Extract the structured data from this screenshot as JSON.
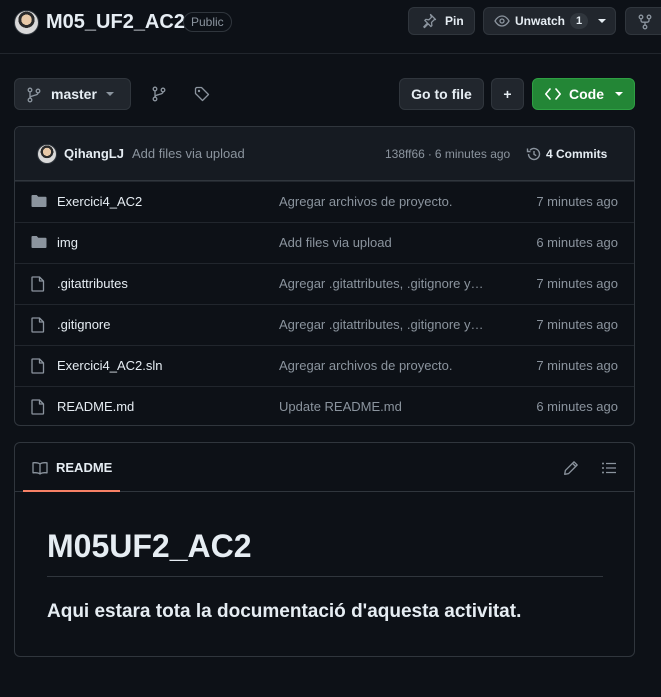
{
  "repo": {
    "name": "M05_UF2_AC2",
    "visibility": "Public"
  },
  "header_actions": {
    "pin_label": "Pin",
    "unwatch_label": "Unwatch",
    "watch_count": "1"
  },
  "toolbar": {
    "branch": "master",
    "goto_file": "Go to file",
    "add": "+",
    "code": "Code"
  },
  "latest_commit": {
    "author": "QihangLJ",
    "message": "Add files via upload",
    "sha": "138ff66",
    "separator": "·",
    "time": "6 minutes ago",
    "commits_label": "4 Commits"
  },
  "files": [
    {
      "type": "folder",
      "name": "Exercici4_AC2",
      "message": "Agregar archivos de proyecto.",
      "date": "7 minutes ago"
    },
    {
      "type": "folder",
      "name": "img",
      "message": "Add files via upload",
      "date": "6 minutes ago"
    },
    {
      "type": "file",
      "name": ".gitattributes",
      "message": "Agregar .gitattributes, .gitignore y…",
      "date": "7 minutes ago"
    },
    {
      "type": "file",
      "name": ".gitignore",
      "message": "Agregar .gitattributes, .gitignore y…",
      "date": "7 minutes ago"
    },
    {
      "type": "file",
      "name": "Exercici4_AC2.sln",
      "message": "Agregar archivos de proyecto.",
      "date": "7 minutes ago"
    },
    {
      "type": "file",
      "name": "README.md",
      "message": "Update README.md",
      "date": "6 minutes ago"
    }
  ],
  "readme": {
    "tab_label": "README",
    "heading": "M05UF2_AC2",
    "paragraph": "Aqui estara tota la documentació d'aquesta activitat."
  },
  "colors": {
    "background": "#0d1117",
    "surface": "#161b22",
    "border": "#30363d",
    "text": "#e6edf3",
    "muted": "#8b949e",
    "code_button": "#238636",
    "readme_underline": "#f78166"
  },
  "icons": {
    "pin": "pin-icon",
    "eye": "eye-icon",
    "fork": "repo-forked-icon",
    "branch": "git-branch-icon",
    "tag": "tag-icon",
    "code": "code-icon",
    "history": "history-icon",
    "folder": "file-directory-icon",
    "file": "file-icon",
    "book": "book-icon",
    "pencil": "pencil-icon",
    "toc": "list-unordered-icon"
  }
}
